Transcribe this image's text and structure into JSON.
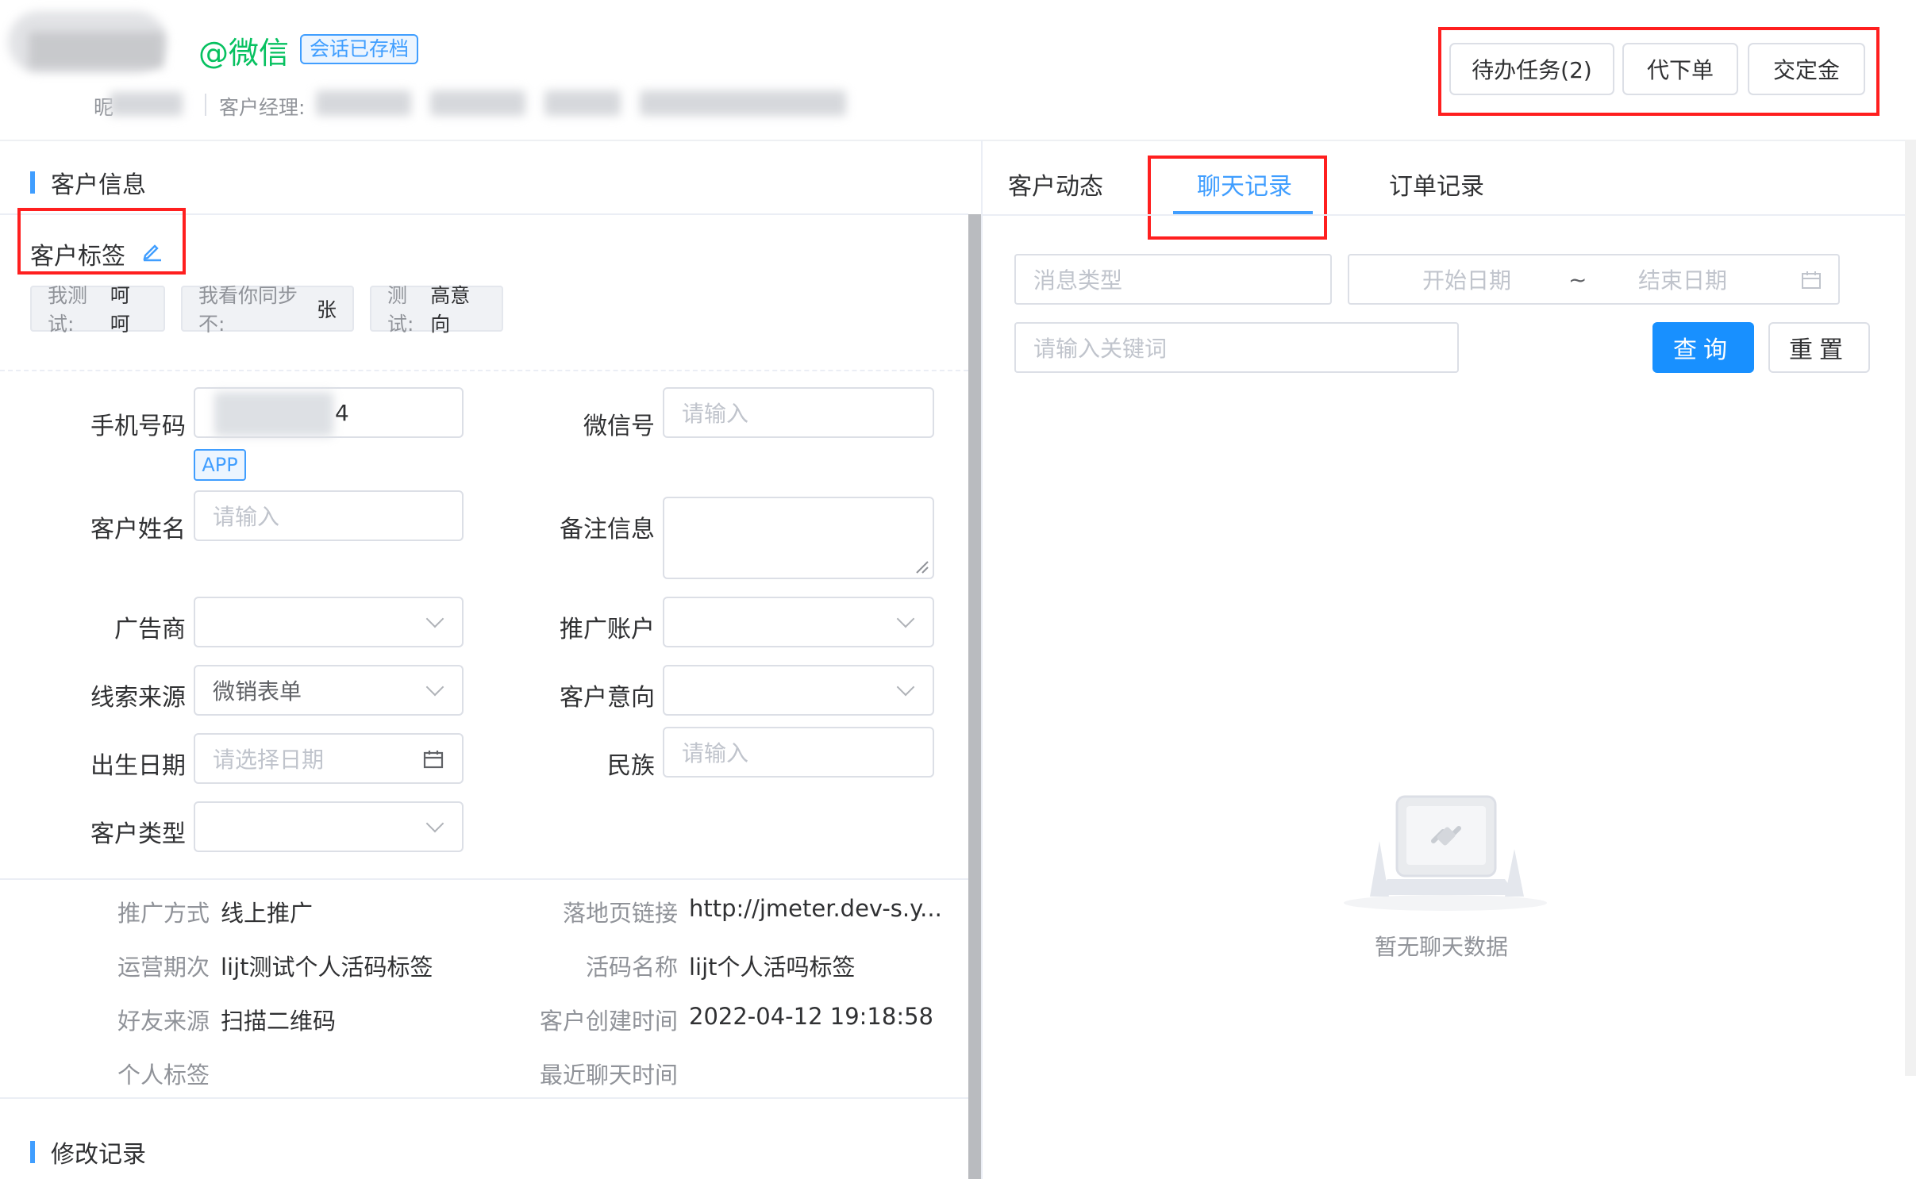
{
  "header": {
    "wechat_tag": "@微信",
    "archived_badge": "会话已存档",
    "nickname_prefix": "昵",
    "manager_label": "客户经理:",
    "buttons": {
      "pending_tasks": "待办任务(2)",
      "place_order": "代下单",
      "deposit": "交定金"
    }
  },
  "left": {
    "section_title": "客户信息",
    "tags_label": "客户标签",
    "tags": [
      {
        "key": "我测试:",
        "value": "呵呵"
      },
      {
        "key": "我看你同步不:",
        "value": "张"
      },
      {
        "key": "测试:",
        "value": "高意向"
      }
    ],
    "form": {
      "phone_label": "手机号码",
      "phone_value": "4",
      "phone_badge": "APP",
      "wechat_label": "微信号",
      "wechat_placeholder": "请输入",
      "name_label": "客户姓名",
      "name_placeholder": "请输入",
      "remark_label": "备注信息",
      "advertiser_label": "广告商",
      "promo_account_label": "推广账户",
      "lead_source_label": "线索来源",
      "lead_source_value": "微销表单",
      "intent_label": "客户意向",
      "birthday_label": "出生日期",
      "birthday_placeholder": "请选择日期",
      "ethnicity_label": "民族",
      "ethnicity_placeholder": "请输入",
      "customer_type_label": "客户类型"
    },
    "info": {
      "promo_method_label": "推广方式",
      "promo_method_value": "线上推广",
      "landing_label": "落地页链接",
      "landing_value": "http://jmeter.dev-s.y...",
      "ops_period_label": "运营期次",
      "ops_period_value": "lijt测试个人活码标签",
      "live_code_label": "活码名称",
      "live_code_value": "lijt个人活吗标签",
      "friend_source_label": "好友来源",
      "friend_source_value": "扫描二维码",
      "created_label": "客户创建时间",
      "created_value": "2022-04-12 19:18:58",
      "personal_tags_label": "个人标签",
      "last_chat_label": "最近聊天时间"
    },
    "history_title": "修改记录"
  },
  "right": {
    "tabs": [
      "客户动态",
      "聊天记录",
      "订单记录"
    ],
    "active_tab": 1,
    "filters": {
      "msg_type_placeholder": "消息类型",
      "start_date": "开始日期",
      "date_sep": "~",
      "end_date": "结束日期",
      "keyword_placeholder": "请输入关键词"
    },
    "buttons": {
      "query": "查询",
      "reset": "重置"
    },
    "empty_text": "暂无聊天数据"
  }
}
